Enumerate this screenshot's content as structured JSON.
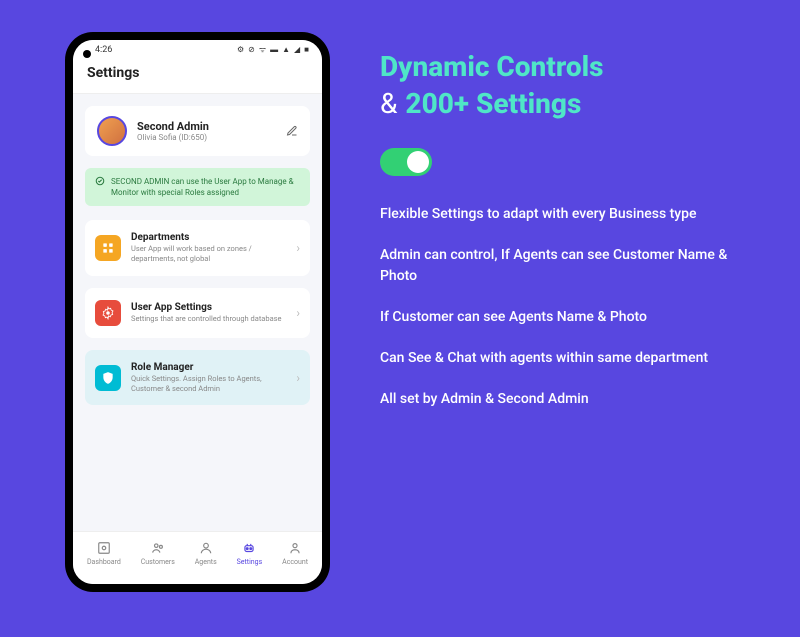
{
  "statusbar": {
    "time": "4:26",
    "icons_text": "⚙ ⊘ ᯤ ▬ ▲ ◢ ■"
  },
  "page": {
    "title": "Settings"
  },
  "admin": {
    "role": "Second Admin",
    "name": "Olivia Sofia (ID:650)"
  },
  "banner": {
    "text": "SECOND ADMIN can use the User App to Manage & Monitor with special Roles assigned"
  },
  "items": [
    {
      "label": "Departments",
      "desc": "User App will work based on zones / departments, not global",
      "icon": "departments-icon",
      "color": "orange"
    },
    {
      "label": "User App Settings",
      "desc": "Settings that are controlled through database",
      "icon": "gear-icon",
      "color": "red"
    },
    {
      "label": "Role Manager",
      "desc": "Quick Settings. Assign Roles to Agents, Customer & second Admin",
      "icon": "shield-icon",
      "color": "cyan",
      "highlighted": true
    }
  ],
  "nav": {
    "items": [
      {
        "label": "Dashboard",
        "icon": "dashboard-icon"
      },
      {
        "label": "Customers",
        "icon": "customers-icon"
      },
      {
        "label": "Agents",
        "icon": "agents-icon"
      },
      {
        "label": "Settings",
        "icon": "settings-icon",
        "active": true
      },
      {
        "label": "Account",
        "icon": "account-icon"
      }
    ]
  },
  "marketing": {
    "headline1": "Dynamic Controls",
    "amp": "&",
    "headline2": "200+ Settings",
    "bullets": [
      "Flexible Settings to adapt with every Business type",
      "Admin can control, If Agents can see Customer Name & Photo",
      "If Customer can see Agents Name & Photo",
      "Can See & Chat with agents within same department",
      "All set by Admin & Second Admin"
    ]
  }
}
